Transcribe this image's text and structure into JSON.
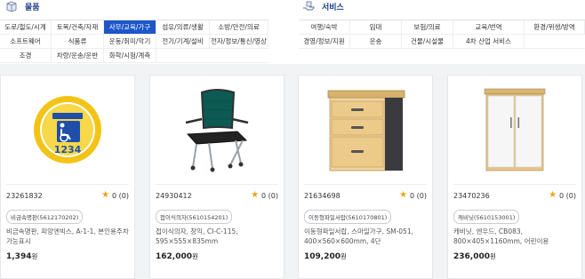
{
  "product_section": {
    "title": "물품",
    "categories": [
      [
        "도로/철도/시계",
        "토목/건축/자재",
        "사무/교육/가구",
        "섬유/의류/생활",
        "소방/안전/의료"
      ],
      [
        "소프트웨어",
        "식품류",
        "운동/취미/악기",
        "전기/기계/설비",
        "전자/정보/통신/영상"
      ],
      [
        "조경",
        "차량/운송/운반",
        "화학/시험/계측",
        "",
        ""
      ]
    ]
  },
  "service_section": {
    "title": "서비스",
    "categories": [
      [
        "여행/숙박",
        "임대",
        "보험/의료",
        "교육/번역",
        "환경/위생/방역"
      ],
      [
        "경영/정보/지원",
        "운송",
        "건물/시설물",
        "4차 산업 서비스",
        ""
      ]
    ]
  },
  "products": [
    {
      "code": "23261832",
      "rating": "0 (0)",
      "tag": "비금속명판(5612170202)",
      "desc": "비금속명판, 피앙엔빅스, A-1-1, 본인용주차 가능표시",
      "price": "1,394",
      "currency": "원",
      "image_text": "1234"
    },
    {
      "code": "24930412",
      "rating": "0 (0)",
      "tag": "접이식의자(5610154201)",
      "desc": "접이식의자, 창익, CI-C-115, 595×555×835mm",
      "price": "162,000",
      "currency": "원"
    },
    {
      "code": "21634698",
      "rating": "0 (0)",
      "tag": "이동형파일서랍(5610170801)",
      "desc": "이동형파일서랍, 스마일가구, SM-051, 400×560×600mm, 4단",
      "price": "109,200",
      "currency": "원"
    },
    {
      "code": "23470236",
      "rating": "0 (0)",
      "tag": "캐비닛(5610153001)",
      "desc": "캐비닛, 엔우드, CB083, 800×405×1160mm, 어린이용",
      "price": "236,000",
      "currency": "원"
    }
  ]
}
